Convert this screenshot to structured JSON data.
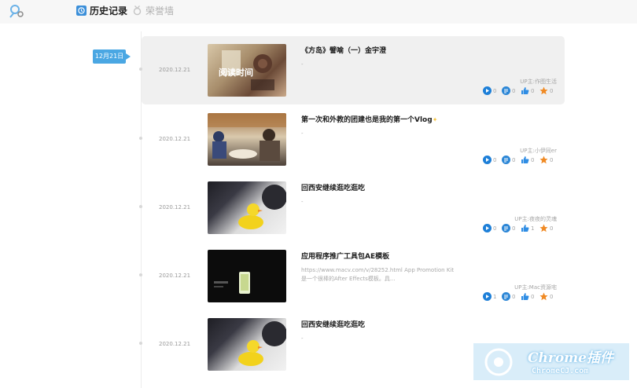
{
  "header": {
    "tab_history": "历史记录",
    "tab_honor": "荣誉墙"
  },
  "timeline": {
    "date_badge": "12月21日"
  },
  "items": [
    {
      "date": "2020.12.21",
      "title": "《方岛》譬喻（一）金宇澄",
      "desc": "-",
      "uploader": "UP主:作图生活",
      "play": "0",
      "danmaku": "0",
      "like": "0",
      "coin": "0",
      "thumb_text": "阅读时间"
    },
    {
      "date": "2020.12.21",
      "title": "第一次和外教的团建也是我的第一个Vlog",
      "desc": "-",
      "uploader": "UP主:小伊同er",
      "play": "0",
      "danmaku": "0",
      "like": "0",
      "coin": "0",
      "thumb_text": ""
    },
    {
      "date": "2020.12.21",
      "title": "回西安继续逛吃逛吃",
      "desc": "-",
      "uploader": "UP主:夜夜的灵魂",
      "play": "0",
      "danmaku": "0",
      "like": "1",
      "coin": "0",
      "thumb_text": ""
    },
    {
      "date": "2020.12.21",
      "title": "应用程序推广工具包AE模板",
      "desc": "https://www.macv.com/v/28252.html App Promotion Kit是一个很棒的After Effects模板。具...",
      "uploader": "UP主:Mac资源宅",
      "play": "1",
      "danmaku": "0",
      "like": "0",
      "coin": "0",
      "thumb_text": ""
    },
    {
      "date": "2020.12.21",
      "title": "回西安继续逛吃逛吃",
      "desc": "-",
      "uploader": "",
      "play": "",
      "danmaku": "",
      "like": "",
      "coin": "",
      "thumb_text": ""
    }
  ],
  "watermark": {
    "main": "Chrome插件",
    "sub": "ChromeCJ.com"
  },
  "colors": {
    "accent": "#4aa7e3",
    "play": "#1d7fd8",
    "danmaku": "#2b86d6",
    "like": "#2f8de4",
    "coin": "#f08a24"
  }
}
